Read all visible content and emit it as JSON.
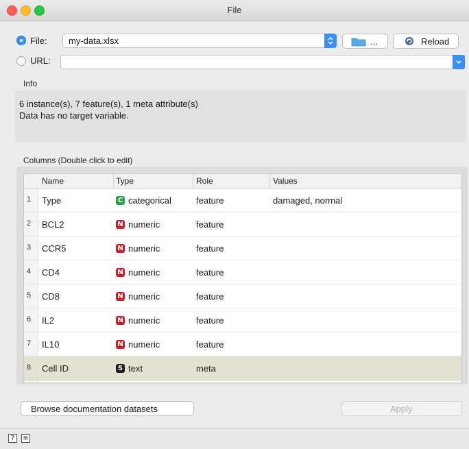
{
  "window": {
    "title": "File"
  },
  "source": {
    "file_label": "File:",
    "file_value": "my-data.xlsx",
    "browse_label": "...",
    "reload_label": "Reload",
    "url_label": "URL:",
    "url_value": ""
  },
  "info": {
    "section_label": "Info",
    "line1": "6 instance(s), 7 feature(s), 1 meta attribute(s)",
    "line2": "Data has no target variable."
  },
  "columns": {
    "section_label": "Columns (Double click to edit)",
    "headers": [
      "Name",
      "Type",
      "Role",
      "Values"
    ],
    "rows": [
      {
        "num": "1",
        "name": "Type",
        "badge": "C",
        "badge_color": "#2aa34a",
        "type": "categorical",
        "role": "feature",
        "values": "damaged, normal"
      },
      {
        "num": "2",
        "name": "BCL2",
        "badge": "N",
        "badge_color": "#c8202c",
        "type": "numeric",
        "role": "feature",
        "values": ""
      },
      {
        "num": "3",
        "name": "CCR5",
        "badge": "N",
        "badge_color": "#c8202c",
        "type": "numeric",
        "role": "feature",
        "values": ""
      },
      {
        "num": "4",
        "name": "CD4",
        "badge": "N",
        "badge_color": "#c8202c",
        "type": "numeric",
        "role": "feature",
        "values": ""
      },
      {
        "num": "5",
        "name": "CD8",
        "badge": "N",
        "badge_color": "#c8202c",
        "type": "numeric",
        "role": "feature",
        "values": ""
      },
      {
        "num": "6",
        "name": "IL2",
        "badge": "N",
        "badge_color": "#c8202c",
        "type": "numeric",
        "role": "feature",
        "values": ""
      },
      {
        "num": "7",
        "name": "IL10",
        "badge": "N",
        "badge_color": "#c8202c",
        "type": "numeric",
        "role": "feature",
        "values": ""
      },
      {
        "num": "8",
        "name": "Cell ID",
        "badge": "S",
        "badge_color": "#1e1e1e",
        "type": "text",
        "role": "meta",
        "values": ""
      }
    ]
  },
  "actions": {
    "browse_docs_label": "Browse documentation datasets",
    "apply_label": "Apply"
  },
  "statusbar": {
    "help_icon_glyph": "?",
    "report_icon_glyph": "≡"
  }
}
